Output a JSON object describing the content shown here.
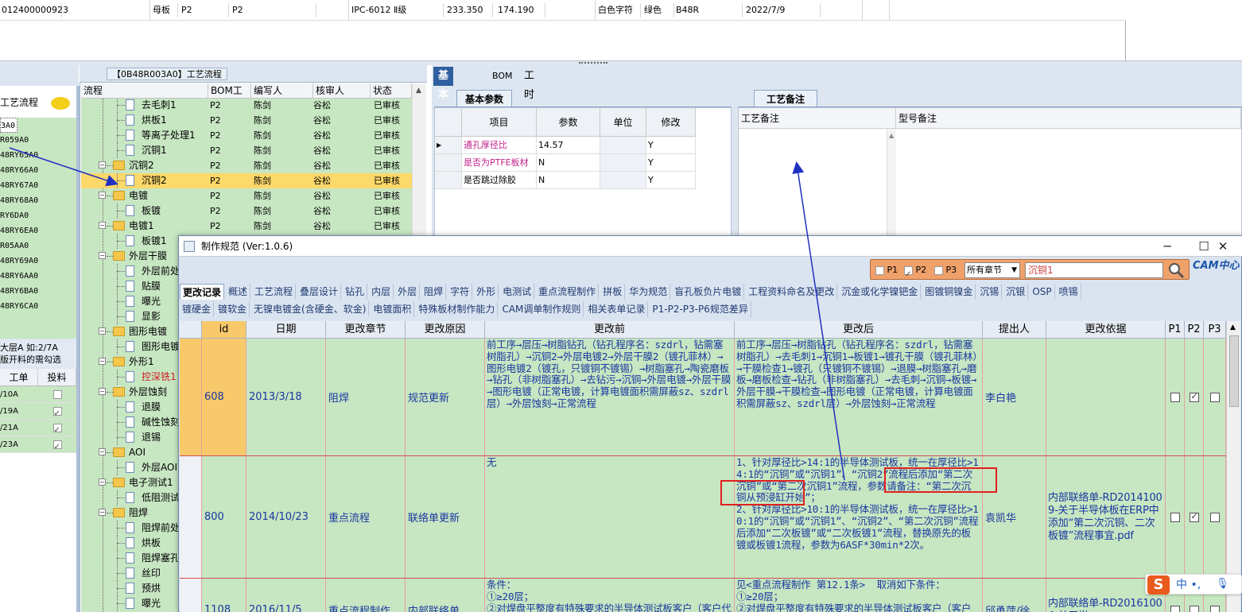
{
  "top_row": {
    "code": "012400000923",
    "type": "母板",
    "bom": "P2",
    "plant": "P2",
    "spec": "IPC-6012 Ⅱ级",
    "v1": "233.350",
    "v2": "174.190",
    "char_color": "白色字符",
    "mask_color": "绿色",
    "model": "B48R",
    "date": "2022/7/9"
  },
  "left_panel": {
    "title": "工艺流程",
    "items": [
      "3A0",
      "R059A0",
      "48RY65A0",
      "48RY66A0",
      "48RY67A0",
      "48RY68A0",
      "RY6DA0",
      "48RY6EA0",
      "R05AA0",
      "48RY69A0",
      "48RY6AA0",
      "48RY6BA0",
      "48RY6CA0"
    ],
    "info": "大层A 如:2/7A\n版开料的需勾选",
    "table_head": [
      "工单",
      "投料"
    ],
    "rows": [
      {
        "c": "/10A",
        "on": false
      },
      {
        "c": "/19A",
        "on": true
      },
      {
        "c": "/21A",
        "on": true
      },
      {
        "c": "/23A",
        "on": true
      }
    ]
  },
  "tree_panel": {
    "title": "【0B48R003A0】工艺流程",
    "headers": [
      "流程",
      "BOM工厂",
      "编写人",
      "核审人",
      "状态"
    ],
    "rows": [
      {
        "name": "去毛刺1",
        "bom": "P2",
        "writer": "陈剑",
        "reviewer": "谷松",
        "status": "已审核"
      },
      {
        "name": "烘板1",
        "bom": "P2",
        "writer": "陈剑",
        "reviewer": "谷松",
        "status": "已审核"
      },
      {
        "name": "等离子处理1",
        "bom": "P2",
        "writer": "陈剑",
        "reviewer": "谷松",
        "status": "已审核"
      },
      {
        "name": "沉铜1",
        "bom": "P2",
        "writer": "陈剑",
        "reviewer": "谷松",
        "status": "已审核"
      },
      {
        "name": "沉铜2",
        "bom": "P2",
        "writer": "陈剑",
        "reviewer": "谷松",
        "status": "已审核"
      },
      {
        "name": "沉铜2",
        "bom": "P2",
        "writer": "陈剑",
        "reviewer": "谷松",
        "status": "已审核"
      },
      {
        "name": "电镀",
        "bom": "P2",
        "writer": "陈剑",
        "reviewer": "谷松",
        "status": "已审核"
      },
      {
        "name": "板镀",
        "bom": "P2",
        "writer": "陈剑",
        "reviewer": "谷松",
        "status": "已审核"
      },
      {
        "name": "电镀1",
        "bom": "P2",
        "writer": "陈剑",
        "reviewer": "谷松",
        "status": "已审核"
      },
      {
        "name": "板镀1",
        "bom": "P2",
        "writer": "陈剑",
        "reviewer": "",
        "status": ""
      },
      {
        "name": "外层干膜",
        "bom": "",
        "writer": "",
        "reviewer": "",
        "status": ""
      },
      {
        "name": "外层前处",
        "bom": "",
        "writer": "",
        "reviewer": "",
        "status": ""
      },
      {
        "name": "贴膜",
        "bom": "",
        "writer": "",
        "reviewer": "",
        "status": ""
      },
      {
        "name": "曝光",
        "bom": "",
        "writer": "",
        "reviewer": "",
        "status": ""
      },
      {
        "name": "显影",
        "bom": "",
        "writer": "",
        "reviewer": "",
        "status": ""
      },
      {
        "name": "图形电镀",
        "bom": "",
        "writer": "",
        "reviewer": "",
        "status": ""
      },
      {
        "name": "图形电镀",
        "bom": "",
        "writer": "",
        "reviewer": "",
        "status": ""
      },
      {
        "name": "外形1",
        "bom": "",
        "writer": "",
        "reviewer": "",
        "status": ""
      },
      {
        "name": "控深铣1",
        "bom": "",
        "writer": "",
        "reviewer": "",
        "status": ""
      },
      {
        "name": "外层蚀刻",
        "bom": "",
        "writer": "",
        "reviewer": "",
        "status": ""
      },
      {
        "name": "退膜",
        "bom": "",
        "writer": "",
        "reviewer": "",
        "status": ""
      },
      {
        "name": "碱性蚀刻",
        "bom": "",
        "writer": "",
        "reviewer": "",
        "status": ""
      },
      {
        "name": "退锡",
        "bom": "",
        "writer": "",
        "reviewer": "",
        "status": ""
      },
      {
        "name": "AOI",
        "bom": "",
        "writer": "",
        "reviewer": "",
        "status": ""
      },
      {
        "name": "外层AOI",
        "bom": "",
        "writer": "",
        "reviewer": "",
        "status": ""
      },
      {
        "name": "电子测试1",
        "bom": "",
        "writer": "",
        "reviewer": "",
        "status": ""
      },
      {
        "name": "低阻测试",
        "bom": "",
        "writer": "",
        "reviewer": "",
        "status": ""
      },
      {
        "name": "阻焊",
        "bom": "",
        "writer": "",
        "reviewer": "",
        "status": ""
      },
      {
        "name": "阻焊前处",
        "bom": "",
        "writer": "",
        "reviewer": "",
        "status": ""
      },
      {
        "name": "烘板",
        "bom": "",
        "writer": "",
        "reviewer": "",
        "status": ""
      },
      {
        "name": "阻焊塞孔",
        "bom": "",
        "writer": "",
        "reviewer": "",
        "status": ""
      },
      {
        "name": "丝印",
        "bom": "",
        "writer": "",
        "reviewer": "",
        "status": ""
      },
      {
        "name": "预烘",
        "bom": "",
        "writer": "",
        "reviewer": "",
        "status": ""
      },
      {
        "name": "曝光",
        "bom": "",
        "writer": "",
        "reviewer": "",
        "status": ""
      }
    ]
  },
  "info_tabs": [
    "基本信息",
    "BOM",
    "工时"
  ],
  "basic_params": {
    "tab": "基本参数",
    "headers": [
      "项目",
      "参数",
      "单位",
      "修改"
    ],
    "rows": [
      {
        "item": "通孔厚径比",
        "param": "14.57",
        "unit": "",
        "mod": "Y"
      },
      {
        "item": "是否为PTFE板材",
        "param": "N",
        "unit": "",
        "mod": "Y"
      },
      {
        "item": "是否跳过除胶",
        "param": "N",
        "unit": "",
        "mod": "Y"
      }
    ]
  },
  "process_notes": {
    "tab": "工艺备注",
    "col1": "工艺备注",
    "col2": "型号备注"
  },
  "dialog": {
    "title": "制作规范 (Ver:1.0.6)",
    "search": {
      "p1": "P1",
      "p2": "P2",
      "p3": "P3",
      "chapter": "所有章节",
      "keyword": "沉铜1"
    },
    "logo": "CAM中心",
    "chapters_row1": [
      "更改记录",
      "概述",
      "工艺流程",
      "叠层设计",
      "钻孔",
      "内层",
      "外层",
      "阻焊",
      "字符",
      "外形",
      "电测试",
      "重点流程制作",
      "拼板",
      "华为规范",
      "盲孔板负片电镀",
      "工程资料命名及更改",
      "沉金或化学镍钯金",
      "图镀铜镍金",
      "沉锡",
      "沉银",
      "OSP",
      "喷锡"
    ],
    "chapters_row2": [
      "镀硬金",
      "镀软金",
      "无镍电镀金(含硬金、软金)",
      "电镀面积",
      "特殊板材制作能力",
      "CAM调单制作规则",
      "相关表单记录",
      "P1-P2-P3-P6规范差异"
    ],
    "headers": [
      "id",
      "日期",
      "更改章节",
      "更改原因",
      "更改前",
      "更改后",
      "提出人",
      "更改依据",
      "P1",
      "P2",
      "P3"
    ],
    "rows": [
      {
        "id": "608",
        "date": "2013/3/18",
        "chapter": "阻焊",
        "reason": "规范更新",
        "before": "前工序→层压→树脂钻孔（钻孔程序名：szdrl，钻需塞树脂孔）→沉铜2→外层电镀2→外层干膜2（镀孔菲林）→图形电镀2（镀孔，只镀铜不镀锡）→树脂塞孔→陶瓷磨板→钻孔（非树脂塞孔）→去钻污→沉铜→外层电镀→外层干膜→图形电镀（正常电镀，计算电镀面积需屏蔽sz、szdrl层）→外层蚀刻→正常流程",
        "after": "前工序→层压→树脂钻孔（钻孔程序名：szdrl，钻需塞树脂孔）→去毛刺1→沉铜1→板镀1→镀孔干膜（镀孔菲林）→干膜检查1→镀孔（只镀铜不镀锡）→退膜→树脂塞孔→磨板→磨板检查→钻孔（非树脂塞孔）→去毛刺→沉铜→板镀→外层干膜→干膜检查→图形电镀（正常电镀，计算电镀面积需屏蔽sz、szdrl层）→外层蚀刻→正常流程",
        "proposer": "李白艳",
        "basis": "",
        "p1": false,
        "p2": true,
        "p3": false
      },
      {
        "id": "800",
        "date": "2014/10/23",
        "chapter": "重点流程",
        "reason": "联络单更新",
        "before": "无",
        "after": "1、针对厚径比>14:1的半导体测试板，统一在厚径比>14:1的“沉铜”或“沉铜1”、“沉铜2”流程后添加“第二次沉铜”或“第二次沉铜1”流程，参数请备注：“第二次沉铜从预浸缸开始”；\n2、针对厚径比>10:1的半导体测试板，统一在厚径比>10:1的“沉铜”或“沉铜1”、“沉铜2”、“第二次沉铜”流程后添加“二次板镀”或“二次板镀1”流程，替换原先的板镀或板镀1流程，参数为6ASF*30min*2次。",
        "proposer": "袁凯华",
        "basis": "内部联络单-RD20141009-关于半导体板在ERP中添加“第二次沉铜、二次板镀”流程事宜.pdf",
        "p1": false,
        "p2": true,
        "p3": false
      },
      {
        "id": "1108",
        "date": "2016/11/5",
        "chapter": "重点流程制作",
        "reason": "内部联络单",
        "before": "条件：\n①≥20层；\n②对焊盘平整度有特殊要求的半导体测试板客户（客户代码：V310、V2VF、V2V5、S92P、",
        "after": "见<重点流程制作 第12.1条>  取消如下条件：\n①≥20层；\n②对焊盘平整度有特殊要求的半导体测试板客户（客户代码：V310、V2VF、",
        "proposer": "邱勇萍/徐",
        "basis": "内部联络单-RD20161004-关于半",
        "p1": false,
        "p2": false,
        "p3": false
      }
    ]
  },
  "ime": {
    "logo": "S",
    "text": "中 •,"
  },
  "colors": {
    "tree_bg": "#c7e6c2",
    "selected_row": "#fdd86a",
    "tab_active": "#2f5f9f",
    "grid_text": "#1a38a0",
    "search_bar": "#f0a16a",
    "annotation": "#e02020",
    "arrow": "#2030c0"
  }
}
